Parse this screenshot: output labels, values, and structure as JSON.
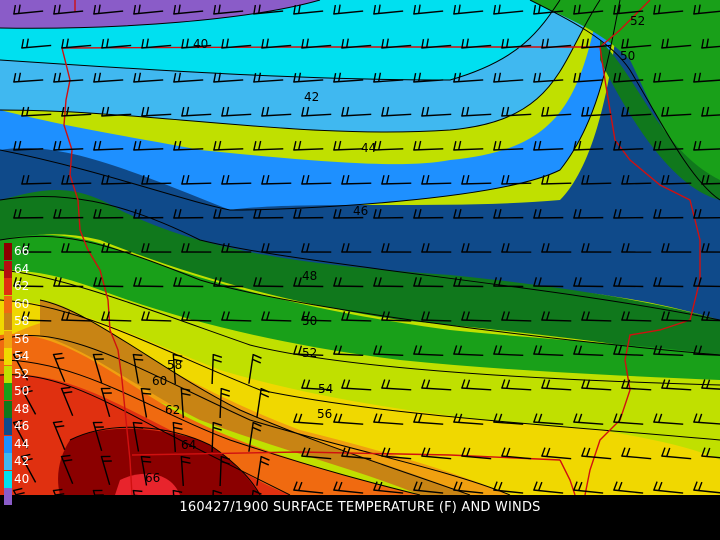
{
  "caption": "160427/1900 SURFACE TEMPERATURE (F) AND WINDS",
  "legend": [
    {
      "label": "66",
      "color": "#8b0000"
    },
    {
      "label": "64",
      "color": "#b31010"
    },
    {
      "label": "62",
      "color": "#e03010"
    },
    {
      "label": "60",
      "color": "#f06a10"
    },
    {
      "label": "58",
      "color": "#c88414"
    },
    {
      "label": "56",
      "color": "#f0a010"
    },
    {
      "label": "54",
      "color": "#f0d800"
    },
    {
      "label": "52",
      "color": "#c0e000"
    },
    {
      "label": "50",
      "color": "#19a019"
    },
    {
      "label": "48",
      "color": "#10781c"
    },
    {
      "label": "46",
      "color": "#0f4a8a"
    },
    {
      "label": "44",
      "color": "#1e90ff"
    },
    {
      "label": "42",
      "color": "#40b8f0"
    },
    {
      "label": "40",
      "color": "#00e0f0"
    },
    {
      "label": "",
      "color": "#8a5cc8"
    }
  ],
  "contour_labels": [
    {
      "text": "40"
    },
    {
      "text": "42"
    },
    {
      "text": "44"
    },
    {
      "text": "46"
    },
    {
      "text": "48"
    },
    {
      "text": "50"
    },
    {
      "text": "52"
    },
    {
      "text": "54"
    },
    {
      "text": "56"
    },
    {
      "text": "58"
    },
    {
      "text": "60"
    },
    {
      "text": "62"
    },
    {
      "text": "64"
    },
    {
      "text": "66"
    },
    {
      "text": "52"
    },
    {
      "text": "50"
    }
  ],
  "colors": {
    "border": "#d01010",
    "contour": "#000000",
    "barb": "#000000",
    "label": "#000000"
  }
}
